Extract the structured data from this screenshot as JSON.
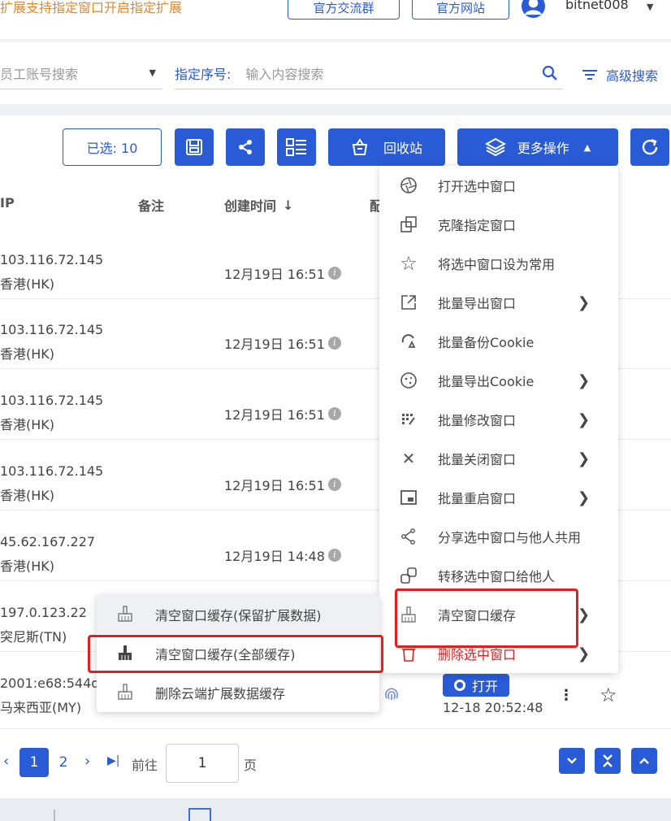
{
  "header": {
    "notice": "扩展支持指定窗口开启指定扩展",
    "community_btn": "官方交流群",
    "website_btn": "官方网站",
    "username": "bitnet008"
  },
  "search": {
    "member_placeholder": "员工账号搜索",
    "seq_label": "指定序号:",
    "seq_placeholder": "输入内容搜索",
    "advanced": "高级搜索"
  },
  "toolbar": {
    "selected": "已选: 10",
    "recycle": "回收站",
    "more": "更多操作"
  },
  "table": {
    "headers": [
      "IP",
      "备注",
      "创建时间",
      "配"
    ],
    "rows": [
      {
        "ip": "103.116.72.145",
        "region": "香港(HK)",
        "time": "12月19日 16:51"
      },
      {
        "ip": "103.116.72.145",
        "region": "香港(HK)",
        "time": "12月19日 16:51"
      },
      {
        "ip": "103.116.72.145",
        "region": "香港(HK)",
        "time": "12月19日 16:51"
      },
      {
        "ip": "103.116.72.145",
        "region": "香港(HK)",
        "time": "12月19日 16:51"
      },
      {
        "ip": "45.62.167.227",
        "region": "香港(HK)",
        "time": "12月19日 14:48"
      },
      {
        "ip": "197.0.123.22",
        "region": "突尼斯(TN)",
        "time": ""
      },
      {
        "ip": "2001:e68:544d",
        "region": "马来西亚(MY)",
        "time": ""
      }
    ],
    "open_label": "打开",
    "last_time": "12-18 20:52:48"
  },
  "more_menu": [
    {
      "label": "打开选中窗口",
      "icon": "aperture-icon",
      "sub": false
    },
    {
      "label": "克隆指定窗口",
      "icon": "clone-icon",
      "sub": false
    },
    {
      "label": "将选中窗口设为常用",
      "icon": "star-icon",
      "sub": false
    },
    {
      "label": "批量导出窗口",
      "icon": "export-icon",
      "sub": true
    },
    {
      "label": "批量备份Cookie",
      "icon": "backup-icon",
      "sub": false
    },
    {
      "label": "批量导出Cookie",
      "icon": "cookie-icon",
      "sub": true
    },
    {
      "label": "批量修改窗口",
      "icon": "edit-grid-icon",
      "sub": true
    },
    {
      "label": "批量关闭窗口",
      "icon": "close-icon",
      "sub": true
    },
    {
      "label": "批量重启窗口",
      "icon": "restart-window-icon",
      "sub": true
    },
    {
      "label": "分享选中窗口与他人共用",
      "icon": "share-icon",
      "sub": false
    },
    {
      "label": "转移选中窗口给他人",
      "icon": "transfer-icon",
      "sub": false
    },
    {
      "label": "清空窗口缓存",
      "icon": "broom-icon",
      "sub": true
    },
    {
      "label": "删除选中窗口",
      "icon": "trash-icon",
      "sub": true
    }
  ],
  "cache_submenu": [
    "清空窗口缓存(保留扩展数据)",
    "清空窗口缓存(全部缓存)",
    "删除云端扩展数据缓存"
  ],
  "pager": {
    "pages": [
      "1",
      "2"
    ],
    "goto_label": "前往",
    "goto_value": "1",
    "page_suffix": "页"
  },
  "colors": {
    "accent": "#2a5bd7",
    "highlight": "#e02020",
    "notice": "#e08a2c"
  }
}
